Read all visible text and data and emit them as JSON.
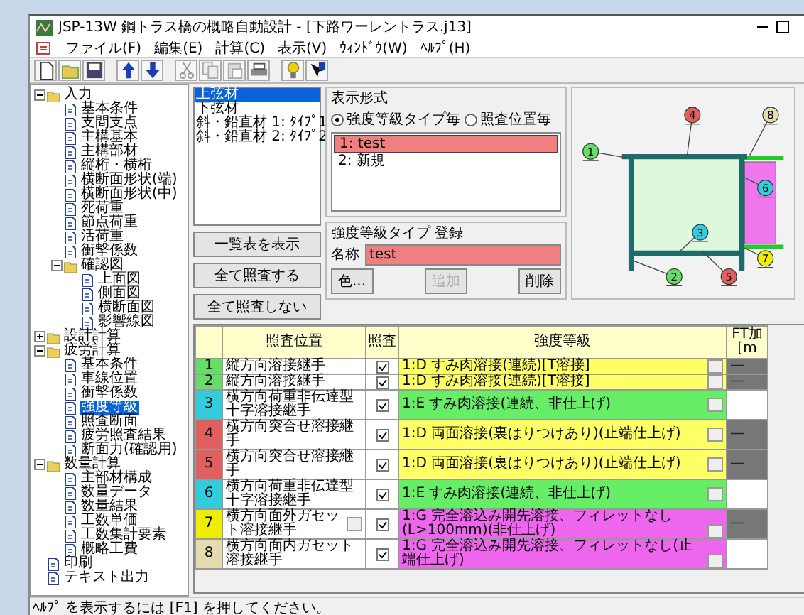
{
  "window": {
    "title": "JSP-13W 鋼トラス橋の概略自動設計 - [下路ワーレントラス.j13]"
  },
  "menu": [
    "ファイル(F)",
    "編集(E)",
    "計算(C)",
    "表示(V)",
    "ｳｨﾝﾄﾞｳ(W)",
    "ﾍﾙﾌﾟ(H)"
  ],
  "tree": [
    {
      "label": "入力",
      "kind": "folder",
      "expanded": true,
      "selected": false,
      "children": [
        {
          "label": "基本条件",
          "kind": "page",
          "selected": false
        },
        {
          "label": "支間支点",
          "kind": "page",
          "selected": false
        },
        {
          "label": "主構基本",
          "kind": "page",
          "selected": false
        },
        {
          "label": "主構部材",
          "kind": "page",
          "selected": false
        },
        {
          "label": "縦桁・横桁",
          "kind": "page",
          "selected": false
        },
        {
          "label": "横断面形状(端)",
          "kind": "page",
          "selected": false
        },
        {
          "label": "横断面形状(中)",
          "kind": "page",
          "selected": false
        },
        {
          "label": "死荷重",
          "kind": "page",
          "selected": false
        },
        {
          "label": "節点荷重",
          "kind": "page",
          "selected": false
        },
        {
          "label": "活荷重",
          "kind": "page",
          "selected": false
        },
        {
          "label": "衝撃係数",
          "kind": "page",
          "selected": false
        },
        {
          "label": "確認図",
          "kind": "folder",
          "expanded": true,
          "selected": false,
          "children": [
            {
              "label": "上面図",
              "kind": "page",
              "selected": false
            },
            {
              "label": "側面図",
              "kind": "page",
              "selected": false
            },
            {
              "label": "横断面図",
              "kind": "page",
              "selected": false
            },
            {
              "label": "影響線図",
              "kind": "page",
              "selected": false
            }
          ]
        }
      ]
    },
    {
      "label": "設計計算",
      "kind": "folder",
      "expanded": false,
      "selected": false
    },
    {
      "label": "疲労計算",
      "kind": "folder",
      "expanded": true,
      "selected": false,
      "children": [
        {
          "label": "基本条件",
          "kind": "page",
          "selected": false
        },
        {
          "label": "車線位置",
          "kind": "page",
          "selected": false
        },
        {
          "label": "衝撃係数",
          "kind": "page",
          "selected": false
        },
        {
          "label": "強度等級",
          "kind": "page",
          "selected": true
        },
        {
          "label": "照査断面",
          "kind": "page",
          "selected": false
        },
        {
          "label": "疲労照査結果",
          "kind": "page",
          "selected": false
        },
        {
          "label": "断面力(確認用)",
          "kind": "page",
          "selected": false
        }
      ]
    },
    {
      "label": "数量計算",
      "kind": "folder",
      "expanded": true,
      "selected": false,
      "children": [
        {
          "label": "主部材構成",
          "kind": "page",
          "selected": false
        },
        {
          "label": "数量データ",
          "kind": "page",
          "selected": false
        },
        {
          "label": "数量結果",
          "kind": "page",
          "selected": false
        },
        {
          "label": "工数単価",
          "kind": "page",
          "selected": false
        },
        {
          "label": "工数集計要素",
          "kind": "page",
          "selected": false
        },
        {
          "label": "概略工費",
          "kind": "page",
          "selected": false
        }
      ]
    },
    {
      "label": "印刷",
      "kind": "page",
      "selected": false
    },
    {
      "label": "テキスト出力",
      "kind": "page",
      "selected": false
    }
  ],
  "members": [
    {
      "label": "上弦材",
      "selected": true
    },
    {
      "label": "下弦材",
      "selected": false
    },
    {
      "label": "斜・鉛直材 1: ﾀｲﾌﾟ1",
      "selected": false
    },
    {
      "label": "斜・鉛直材 2: ﾀｲﾌﾟ2",
      "selected": false
    }
  ],
  "display_mode": {
    "title": "表示形式",
    "options": [
      {
        "label": "強度等級タイプ毎",
        "selected": true
      },
      {
        "label": "照査位置毎",
        "selected": false
      }
    ]
  },
  "grade_types": [
    {
      "label": "1: test",
      "selected": true,
      "color": "#f08080"
    },
    {
      "label": "2: 新規",
      "selected": false
    }
  ],
  "register": {
    "title": "強度等級タイプ 登録",
    "name_label": "名称",
    "name_field": {
      "value": "test",
      "color": "#f08080"
    },
    "buttons": [
      {
        "label": "色...",
        "disabled": false
      },
      {
        "label": "追加",
        "disabled": true
      },
      {
        "label": "削除",
        "disabled": false
      }
    ]
  },
  "side_buttons": [
    "一覧表を表示",
    "全て照査する",
    "全て照査しない"
  ],
  "diagram": {
    "markers": [
      {
        "label": "1",
        "color": "#66dd66"
      },
      {
        "label": "2",
        "color": "#66dd66"
      },
      {
        "label": "3",
        "color": "#33ccdd"
      },
      {
        "label": "4",
        "color": "#e06060"
      },
      {
        "label": "5",
        "color": "#e06060"
      },
      {
        "label": "6",
        "color": "#33ccdd"
      },
      {
        "label": "7",
        "color": "#eeee00"
      },
      {
        "label": "8",
        "color": "#e4dcae"
      }
    ]
  },
  "table": {
    "columns": [
      "照査位置",
      "照査",
      "強度等級"
    ],
    "column_5": [
      "FT加",
      "[m"
    ],
    "rows": [
      {
        "marker": "1",
        "color": "#66dd66",
        "position": "縦方向溶接継手",
        "dropdown": false,
        "checked": true,
        "grade": {
          "text": "1:D すみ肉溶接(連続)[T溶接]",
          "color": "#ffff66"
        },
        "column_5": "—"
      },
      {
        "marker": "2",
        "color": "#66dd66",
        "position": "縦方向溶接継手",
        "dropdown": false,
        "checked": true,
        "grade": {
          "text": "1:D すみ肉溶接(連続)[T溶接]",
          "color": "#ffff66"
        },
        "column_5": "—"
      },
      {
        "marker": "3",
        "color": "#33ccdd",
        "position": "横方向荷重非伝達型十字溶接継手",
        "dropdown": false,
        "checked": true,
        "grade": {
          "text": "1:E すみ肉溶接(連続、非仕上げ)",
          "color": "#66ee66"
        }
      },
      {
        "marker": "4",
        "color": "#e06060",
        "position": "横方向突合せ溶接継手",
        "dropdown": false,
        "checked": true,
        "grade": {
          "text": "1:D 両面溶接(裏はりつけあり)(止端仕上げ)",
          "color": "#ffff66"
        },
        "column_5": "—"
      },
      {
        "marker": "5",
        "color": "#e06060",
        "position": "横方向突合せ溶接継手",
        "dropdown": false,
        "checked": true,
        "grade": {
          "text": "1:D 両面溶接(裏はりつけあり)(止端仕上げ)",
          "color": "#ffff66"
        },
        "column_5": "—"
      },
      {
        "marker": "6",
        "color": "#33ccdd",
        "position": "横方向荷重非伝達型十字溶接継手",
        "dropdown": false,
        "checked": true,
        "grade": {
          "text": "1:E すみ肉溶接(連続、非仕上げ)",
          "color": "#66ee66"
        }
      },
      {
        "marker": "7",
        "color": "#eeee00",
        "position": "横方向面外ガセット溶接継手",
        "dropdown": true,
        "checked": true,
        "grade": {
          "text": "1:G 完全溶込み開先溶接、フィレットなし(L>100mm)(非仕上げ)",
          "color": "#ee66ee"
        },
        "column_5": "—"
      },
      {
        "marker": "8",
        "color": "#e4dcae",
        "position": "横方向面内ガセット溶接継手",
        "dropdown": false,
        "checked": true,
        "grade": {
          "text": "1:G 完全溶込み開先溶接、フィレットなし(止端仕上げ)",
          "color": "#ee66ee"
        }
      }
    ]
  },
  "status_bar": "ﾍﾙﾌﾟ を表示するには [F1] を押してください。"
}
